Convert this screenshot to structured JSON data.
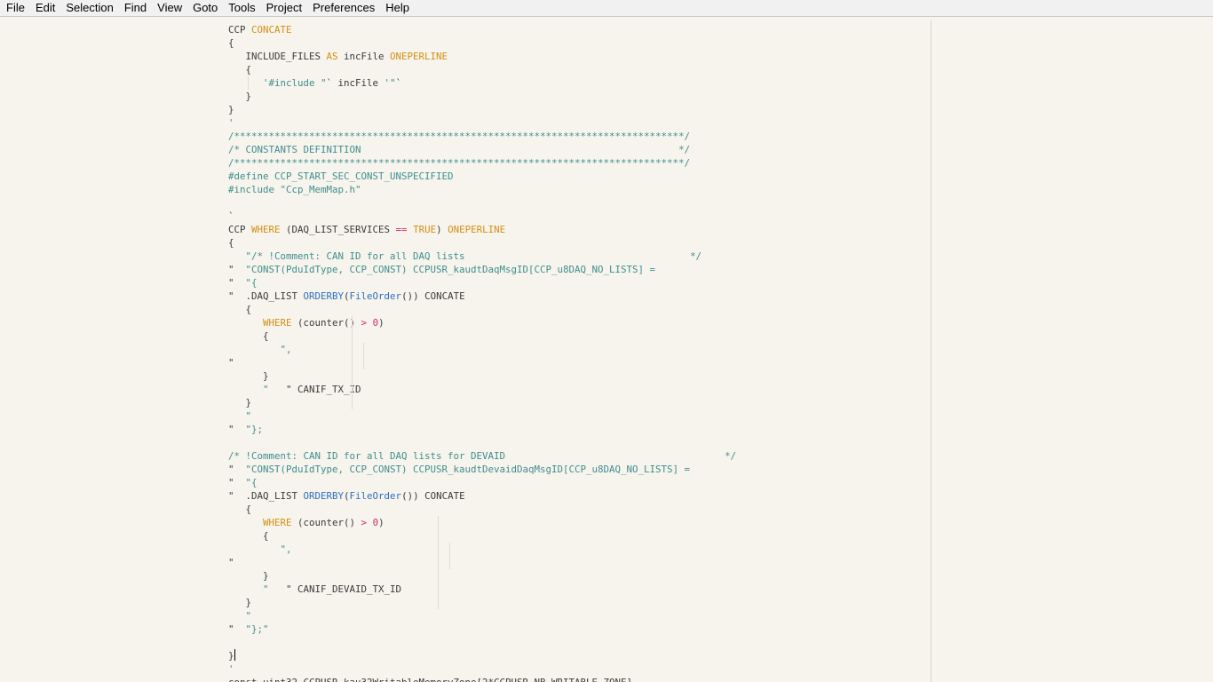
{
  "menubar": {
    "items": [
      "File",
      "Edit",
      "Selection",
      "Find",
      "View",
      "Goto",
      "Tools",
      "Project",
      "Preferences",
      "Help"
    ]
  },
  "colors": {
    "background": "#f7f4ed",
    "comment": "#3e8e8e",
    "keyword": "#d28f14",
    "function": "#2f6ec0",
    "number": "#d2286e",
    "text": "#3a3a3a"
  },
  "code": {
    "lines": [
      [
        [
          "pl",
          "CCP "
        ],
        [
          "kw",
          "CONCATE"
        ]
      ],
      [
        [
          "pl",
          "{"
        ]
      ],
      [
        [
          "pl",
          "   INCLUDE_FILES "
        ],
        [
          "kw",
          "AS"
        ],
        [
          "pl",
          " incFile "
        ],
        [
          "kw",
          "ONEPERLINE"
        ]
      ],
      [
        [
          "pl",
          "   {"
        ]
      ],
      [
        [
          "pl",
          "      "
        ],
        [
          "str",
          "'#include \""
        ],
        [
          "pl",
          "` incFile "
        ],
        [
          "str",
          "'\""
        ],
        [
          "pl",
          "`"
        ]
      ],
      [
        [
          "pl",
          "   }"
        ]
      ],
      [
        [
          "pl",
          "}"
        ]
      ],
      [
        [
          "str",
          "'"
        ]
      ],
      [
        [
          "cm",
          "/******************************************************************************/"
        ]
      ],
      [
        [
          "cm",
          "/* CONSTANTS DEFINITION                                                       */"
        ]
      ],
      [
        [
          "cm",
          "/******************************************************************************/"
        ]
      ],
      [
        [
          "cm",
          "#define CCP_START_SEC_CONST_UNSPECIFIED"
        ]
      ],
      [
        [
          "cm",
          "#include \"Ccp_MemMap.h\""
        ]
      ],
      [
        [
          "pl",
          ""
        ]
      ],
      [
        [
          "pl",
          "`"
        ]
      ],
      [
        [
          "pl",
          "CCP "
        ],
        [
          "kw",
          "WHERE"
        ],
        [
          "pl",
          " (DAQ_LIST_SERVICES "
        ],
        [
          "op",
          "=="
        ],
        [
          "pl",
          " "
        ],
        [
          "kw",
          "TRUE"
        ],
        [
          "pl",
          ") "
        ],
        [
          "kw",
          "ONEPERLINE"
        ]
      ],
      [
        [
          "pl",
          "{"
        ]
      ],
      [
        [
          "pl",
          "   "
        ],
        [
          "str",
          "\"/* !Comment: CAN ID for all DAQ lists                                       */"
        ]
      ],
      [
        [
          "pl",
          "\"  "
        ],
        [
          "str",
          "\"CONST(PduIdType, CCP_CONST) CCPUSR_kaudtDaqMsgID[CCP_u8DAQ_NO_LISTS] ="
        ]
      ],
      [
        [
          "pl",
          "\"  "
        ],
        [
          "str",
          "\"{"
        ]
      ],
      [
        [
          "pl",
          "\"  .DAQ_LIST "
        ],
        [
          "fn",
          "ORDERBY"
        ],
        [
          "pl",
          "("
        ],
        [
          "fn",
          "FileOrder"
        ],
        [
          "pl",
          "()) CONCATE"
        ]
      ],
      [
        [
          "pl",
          "   {"
        ]
      ],
      [
        [
          "pl",
          "      "
        ],
        [
          "kw",
          "WHERE"
        ],
        [
          "pl",
          " (counter() "
        ],
        [
          "op",
          ">"
        ],
        [
          "pl",
          " "
        ],
        [
          "num",
          "0"
        ],
        [
          "pl",
          ")"
        ]
      ],
      [
        [
          "pl",
          "      {"
        ]
      ],
      [
        [
          "pl",
          "         "
        ],
        [
          "str",
          "\","
        ]
      ],
      [
        [
          "pl",
          "\""
        ]
      ],
      [
        [
          "pl",
          "      }"
        ]
      ],
      [
        [
          "pl",
          "      "
        ],
        [
          "str",
          "\""
        ],
        [
          "pl",
          "   \" CANIF_TX_ID"
        ]
      ],
      [
        [
          "pl",
          "   }"
        ]
      ],
      [
        [
          "pl",
          "   "
        ],
        [
          "str",
          "\""
        ]
      ],
      [
        [
          "pl",
          "\"  "
        ],
        [
          "str",
          "\"};"
        ]
      ],
      [
        [
          "pl",
          ""
        ]
      ],
      [
        [
          "cm",
          "/* !Comment: CAN ID for all DAQ lists for DEVAID                                      */"
        ]
      ],
      [
        [
          "pl",
          "\"  "
        ],
        [
          "str",
          "\"CONST(PduIdType, CCP_CONST) CCPUSR_kaudtDevaidDaqMsgID[CCP_u8DAQ_NO_LISTS] ="
        ]
      ],
      [
        [
          "pl",
          "\"  "
        ],
        [
          "str",
          "\"{"
        ]
      ],
      [
        [
          "pl",
          "\"  .DAQ_LIST "
        ],
        [
          "fn",
          "ORDERBY"
        ],
        [
          "pl",
          "("
        ],
        [
          "fn",
          "FileOrder"
        ],
        [
          "pl",
          "()) CONCATE"
        ]
      ],
      [
        [
          "pl",
          "   {"
        ]
      ],
      [
        [
          "pl",
          "      "
        ],
        [
          "kw",
          "WHERE"
        ],
        [
          "pl",
          " (counter() "
        ],
        [
          "op",
          ">"
        ],
        [
          "pl",
          " "
        ],
        [
          "num",
          "0"
        ],
        [
          "pl",
          ")"
        ]
      ],
      [
        [
          "pl",
          "      {"
        ]
      ],
      [
        [
          "pl",
          "         "
        ],
        [
          "str",
          "\","
        ]
      ],
      [
        [
          "pl",
          "\""
        ]
      ],
      [
        [
          "pl",
          "      }"
        ]
      ],
      [
        [
          "pl",
          "      "
        ],
        [
          "str",
          "\""
        ],
        [
          "pl",
          "   \" CANIF_DEVAID_TX_ID"
        ]
      ],
      [
        [
          "pl",
          "   }"
        ]
      ],
      [
        [
          "pl",
          "   "
        ],
        [
          "str",
          "\""
        ]
      ],
      [
        [
          "pl",
          "\"  "
        ],
        [
          "str",
          "\"};\""
        ]
      ],
      [
        [
          "pl",
          ""
        ]
      ],
      [
        [
          "pl",
          "}"
        ]
      ],
      [
        [
          "str",
          "'"
        ]
      ],
      [
        [
          "pl",
          "const uint32 CCPUSR_kau32WritableMemoryZone[2*CCPUSR_NB_WRITABLE_ZONE]"
        ]
      ]
    ],
    "cursor_line": 47
  }
}
